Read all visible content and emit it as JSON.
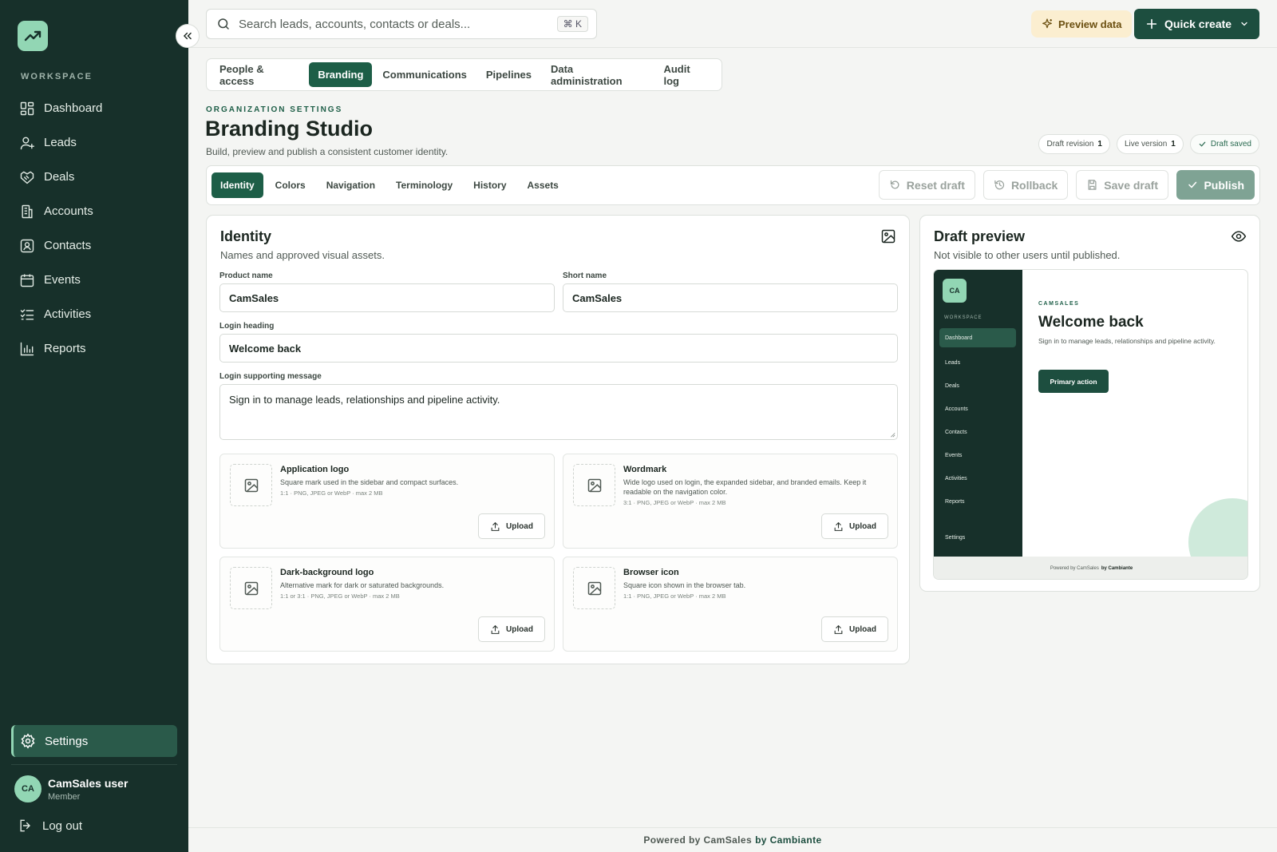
{
  "sidebar": {
    "logo_icon": "trend-up-icon",
    "workspace_label": "WORKSPACE",
    "items": [
      {
        "label": "Dashboard",
        "icon": "dashboard-icon"
      },
      {
        "label": "Leads",
        "icon": "user-plus-icon"
      },
      {
        "label": "Deals",
        "icon": "handshake-icon"
      },
      {
        "label": "Accounts",
        "icon": "building-icon"
      },
      {
        "label": "Contacts",
        "icon": "contact-icon"
      },
      {
        "label": "Events",
        "icon": "calendar-icon"
      },
      {
        "label": "Activities",
        "icon": "list-check-icon"
      },
      {
        "label": "Reports",
        "icon": "bar-chart-icon"
      }
    ],
    "settings_label": "Settings",
    "user": {
      "initials": "CA",
      "name": "CamSales user",
      "role": "Member"
    },
    "logout_label": "Log out"
  },
  "topbar": {
    "search_placeholder": "Search leads, accounts, contacts or deals...",
    "shortcut": "⌘ K",
    "preview_label": "Preview data",
    "quick_create_label": "Quick create"
  },
  "main_tabs": [
    "People & access",
    "Branding",
    "Communications",
    "Pipelines",
    "Data administration",
    "Audit log"
  ],
  "main_tabs_active": "Branding",
  "header": {
    "kicker": "ORGANIZATION SETTINGS",
    "title": "Branding Studio",
    "subtitle": "Build, preview and publish a consistent customer identity."
  },
  "chips": {
    "draft_revision_label": "Draft revision",
    "draft_revision_value": "1",
    "live_version_label": "Live version",
    "live_version_value": "1",
    "saved_label": "Draft saved"
  },
  "sub_tabs": [
    "Identity",
    "Colors",
    "Navigation",
    "Terminology",
    "History",
    "Assets"
  ],
  "sub_tabs_active": "Identity",
  "actions": {
    "reset": "Reset draft",
    "rollback": "Rollback",
    "save": "Save draft",
    "publish": "Publish"
  },
  "identity": {
    "title": "Identity",
    "subtitle": "Names and approved visual assets.",
    "product_name_label": "Product name",
    "product_name_value": "CamSales",
    "short_name_label": "Short name",
    "short_name_value": "CamSales",
    "login_heading_label": "Login heading",
    "login_heading_value": "Welcome back",
    "login_message_label": "Login supporting message",
    "login_message_value": "Sign in to manage leads, relationships and pipeline activity.",
    "assets": [
      {
        "title": "Application logo",
        "desc": "Square mark used in the sidebar and compact surfaces.",
        "meta": "1:1 · PNG, JPEG or WebP · max 2 MB",
        "upload": "Upload"
      },
      {
        "title": "Wordmark",
        "desc": "Wide logo used on login, the expanded sidebar, and branded emails. Keep it readable on the navigation color.",
        "meta": "3:1 · PNG, JPEG or WebP · max 2 MB",
        "upload": "Upload"
      },
      {
        "title": "Dark-background logo",
        "desc": "Alternative mark for dark or saturated backgrounds.",
        "meta": "1:1 or 3:1 · PNG, JPEG or WebP · max 2 MB",
        "upload": "Upload"
      },
      {
        "title": "Browser icon",
        "desc": "Square icon shown in the browser tab.",
        "meta": "1:1 · PNG, JPEG or WebP · max 2 MB",
        "upload": "Upload"
      }
    ]
  },
  "draft_preview": {
    "title": "Draft preview",
    "subtitle": "Not visible to other users until published.",
    "logo_initials": "CA",
    "workspace_label": "WORKSPACE",
    "nav": [
      "Dashboard",
      "Leads",
      "Deals",
      "Accounts",
      "Contacts",
      "Events",
      "Activities",
      "Reports"
    ],
    "settings": "Settings",
    "kicker": "CAMSALES",
    "heading": "Welcome back",
    "message": "Sign in to manage leads, relationships and pipeline activity.",
    "primary_action": "Primary action",
    "footer_prefix": "Powered by CamSales",
    "footer_brand": "by Cambiante"
  },
  "footer": {
    "prefix": "Powered by CamSales",
    "brand": "by Cambiante"
  },
  "colors": {
    "sidebar": "#17302a",
    "accent": "#1d5e47",
    "mint": "#92d6b4"
  }
}
